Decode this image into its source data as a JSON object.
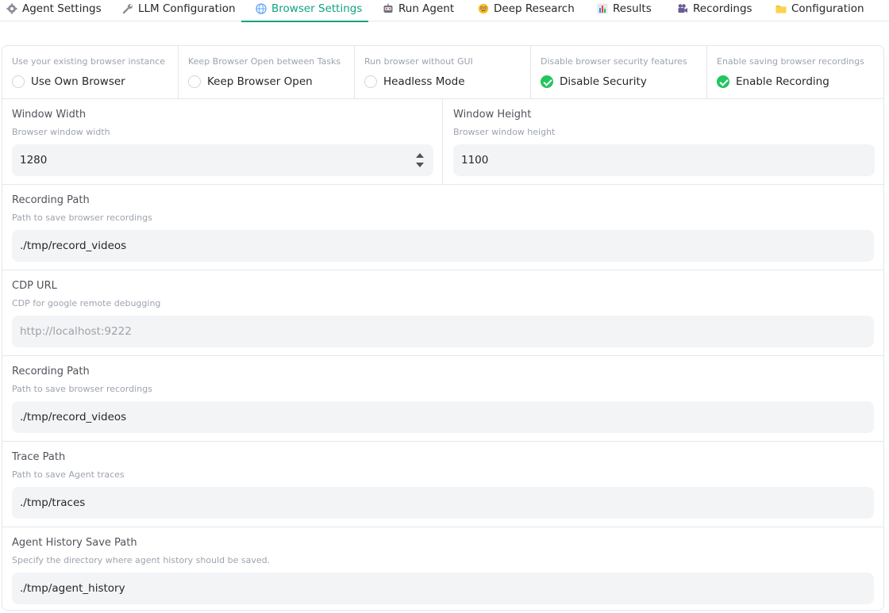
{
  "tabs": [
    {
      "label": "Agent Settings",
      "icon": "gear-icon"
    },
    {
      "label": "LLM Configuration",
      "icon": "wrench-icon"
    },
    {
      "label": "Browser Settings",
      "icon": "globe-icon",
      "active": true
    },
    {
      "label": "Run Agent",
      "icon": "robot-icon"
    },
    {
      "label": "Deep Research",
      "icon": "face-icon"
    },
    {
      "label": "Results",
      "icon": "bar-chart-icon"
    },
    {
      "label": "Recordings",
      "icon": "movie-camera-icon"
    },
    {
      "label": "Configuration",
      "icon": "folder-icon"
    }
  ],
  "checkboxes": [
    {
      "info": "Use your existing browser instance",
      "label": "Use Own Browser",
      "checked": false
    },
    {
      "info": "Keep Browser Open between Tasks",
      "label": "Keep Browser Open",
      "checked": false
    },
    {
      "info": "Run browser without GUI",
      "label": "Headless Mode",
      "checked": false
    },
    {
      "info": "Disable browser security features",
      "label": "Disable Security",
      "checked": true
    },
    {
      "info": "Enable saving browser recordings",
      "label": "Enable Recording",
      "checked": true
    }
  ],
  "window_width": {
    "label": "Window Width",
    "info": "Browser window width",
    "value": "1280"
  },
  "window_height": {
    "label": "Window Height",
    "info": "Browser window height",
    "value": "1100"
  },
  "recording_path_1": {
    "label": "Recording Path",
    "info": "Path to save browser recordings",
    "value": "./tmp/record_videos"
  },
  "cdp_url": {
    "label": "CDP URL",
    "info": "CDP for google remote debugging",
    "value": "",
    "placeholder": "http://localhost:9222"
  },
  "recording_path_2": {
    "label": "Recording Path",
    "info": "Path to save browser recordings",
    "value": "./tmp/record_videos"
  },
  "trace_path": {
    "label": "Trace Path",
    "info": "Path to save Agent traces",
    "value": "./tmp/traces"
  },
  "history_path": {
    "label": "Agent History Save Path",
    "info": "Specify the directory where agent history should be saved.",
    "value": "./tmp/agent_history"
  },
  "colors": {
    "accent": "#10a37f",
    "check": "#22c55e",
    "input_bg": "#f3f4f6",
    "border": "#e5e7eb"
  }
}
